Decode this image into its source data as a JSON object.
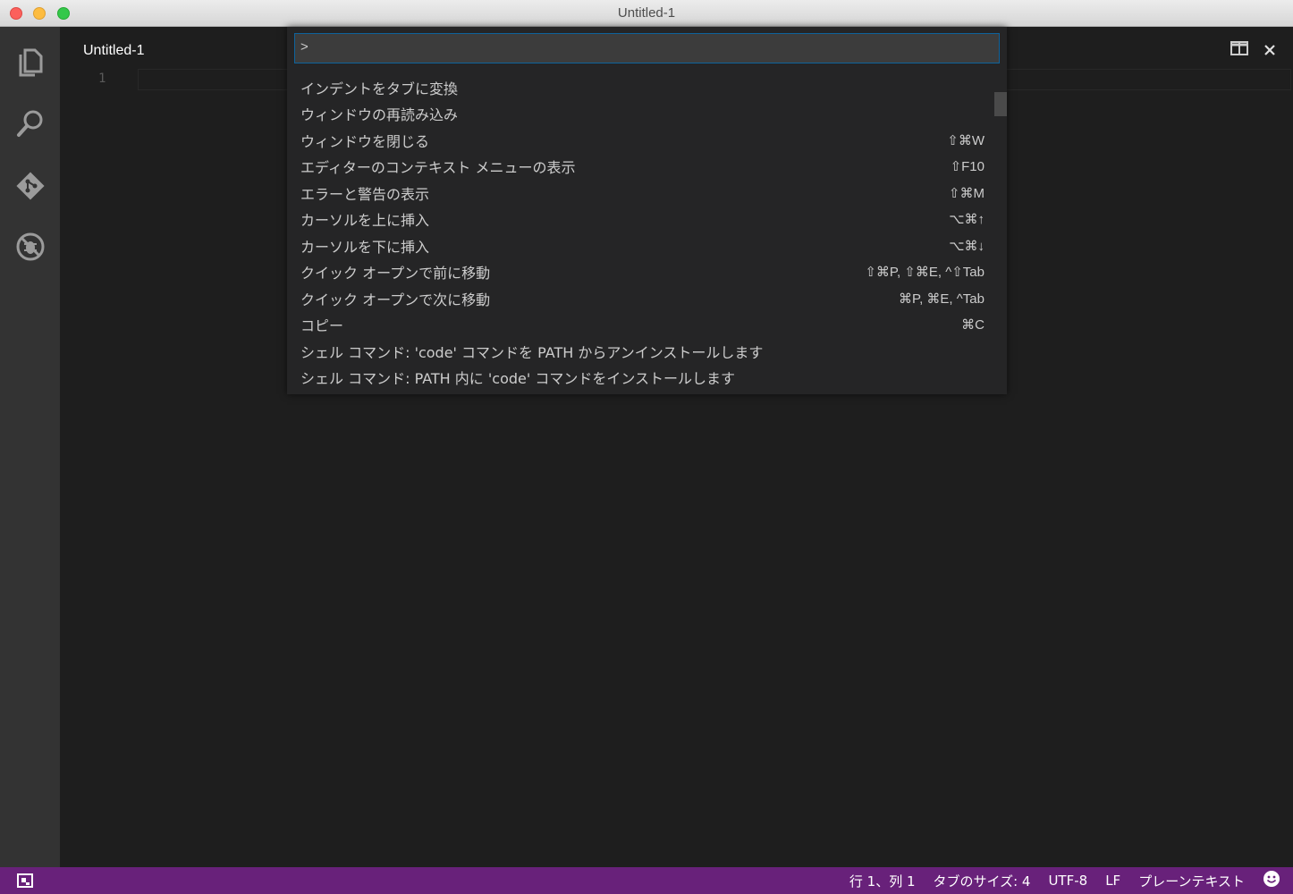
{
  "window": {
    "title": "Untitled-1"
  },
  "activity_bar": {
    "items": [
      {
        "icon": "files-icon"
      },
      {
        "icon": "search-icon"
      },
      {
        "icon": "git-icon"
      },
      {
        "icon": "debug-icon"
      }
    ]
  },
  "editor": {
    "tab_title": "Untitled-1",
    "line_number": "1"
  },
  "command_palette": {
    "input_value": ">",
    "items": [
      {
        "label": "インデントをタブに変換",
        "keybinding": ""
      },
      {
        "label": "ウィンドウの再読み込み",
        "keybinding": ""
      },
      {
        "label": "ウィンドウを閉じる",
        "keybinding": "⇧⌘W"
      },
      {
        "label": "エディターのコンテキスト メニューの表示",
        "keybinding": "⇧F10"
      },
      {
        "label": "エラーと警告の表示",
        "keybinding": "⇧⌘M"
      },
      {
        "label": "カーソルを上に挿入",
        "keybinding": "⌥⌘↑"
      },
      {
        "label": "カーソルを下に挿入",
        "keybinding": "⌥⌘↓"
      },
      {
        "label": "クイック オープンで前に移動",
        "keybinding": "⇧⌘P, ⇧⌘E, ^⇧Tab"
      },
      {
        "label": "クイック オープンで次に移動",
        "keybinding": "⌘P, ⌘E, ^Tab"
      },
      {
        "label": "コピー",
        "keybinding": "⌘C"
      },
      {
        "label": "シェル コマンド: 'code' コマンドを PATH からアンインストールします",
        "keybinding": ""
      },
      {
        "label": "シェル コマンド: PATH 内に 'code' コマンドをインストールします",
        "keybinding": ""
      }
    ]
  },
  "status_bar": {
    "position": "行 1、列 1",
    "tab_size": "タブのサイズ: 4",
    "encoding": "UTF-8",
    "eol": "LF",
    "language": "プレーンテキスト",
    "feedback_icon": "smiley-icon"
  },
  "colors": {
    "status_bar": "#68217a",
    "activity_bar": "#333333",
    "editor_bg": "#1e1e1e",
    "input_border": "#0e639c"
  }
}
